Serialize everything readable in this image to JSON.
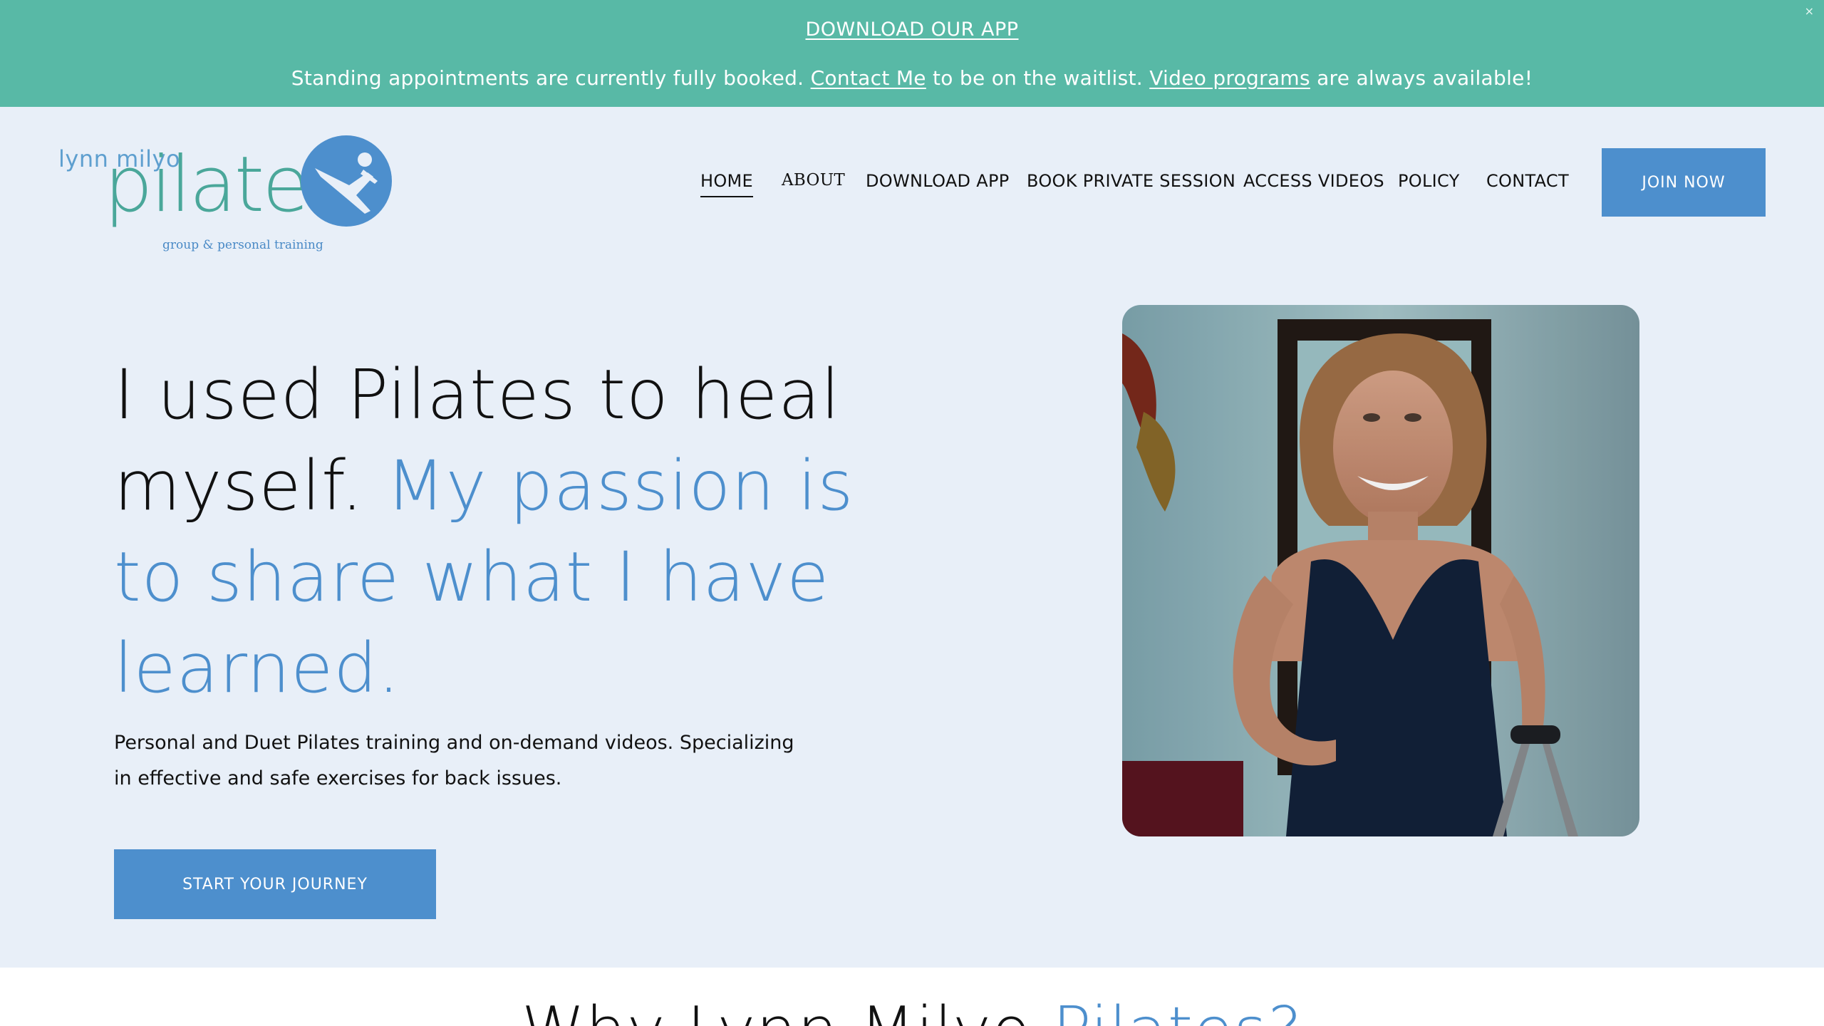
{
  "announcement": {
    "app_link": "DOWNLOAD OUR APP",
    "message_part1": "Standing appointments are currently fully booked. ",
    "contact_link": "Contact Me",
    "message_part2": " to be on the waitlist. ",
    "video_link": "Video programs",
    "message_part3": " are always available!",
    "close": "×"
  },
  "logo": {
    "small_text": "lynn milyo",
    "big_text": "pilates",
    "tagline": "group & personal training"
  },
  "nav": {
    "items": [
      {
        "label": "HOME"
      },
      {
        "label": "ABOUT"
      },
      {
        "label": "DOWNLOAD APP"
      },
      {
        "label": "BOOK PRIVATE SESSION"
      },
      {
        "label": "ACCESS VIDEOS"
      },
      {
        "label": "POLICY"
      },
      {
        "label": "CONTACT"
      }
    ],
    "join": "JOIN NOW"
  },
  "hero": {
    "title_plain": "I used Pilates to heal myself. ",
    "title_accent": "My passion is to share what I have learned.",
    "subtitle": "Personal and Duet Pilates training and on-demand videos.  Specializing in effective and safe exercises for back issues.",
    "cta": "START YOUR JOURNEY"
  },
  "section2": {
    "heading_plain": "Why Lynn Milyo ",
    "heading_accent": "Pilates?"
  },
  "colors": {
    "announcement_bg": "#58b9a6",
    "page_bg": "#e8eff8",
    "accent": "#4d8fcd",
    "logo_teal": "#4aa79a"
  }
}
